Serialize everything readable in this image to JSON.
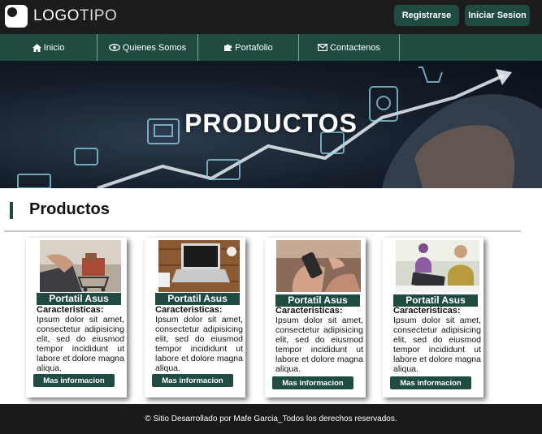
{
  "header": {
    "logo_bold": "LOGO",
    "logo_light": "TIPO",
    "register_label": "Registrarse",
    "login_label": "Iniciar Sesion"
  },
  "nav": {
    "items": [
      {
        "label": "Inicio",
        "icon": "home-icon"
      },
      {
        "label": "Quienes Somos",
        "icon": "eye-icon"
      },
      {
        "label": "Portafolio",
        "icon": "puzzle-icon"
      },
      {
        "label": "Contactenos",
        "icon": "envelope-icon"
      }
    ]
  },
  "hero": {
    "title": "PRODUCTOS"
  },
  "section": {
    "title": "Productos"
  },
  "products": [
    {
      "title": "Portatil Asus",
      "features_label": "Caracteristicas:",
      "description": "Ipsum dolor sit amet, consectetur adipisicing elit, sed do eiusmod tempor incididunt ut labore et dolore magna aliqua.",
      "button": "Mas informacion"
    },
    {
      "title": "Portatil Asus",
      "features_label": "Caracteristicas:",
      "description": "Ipsum dolor sit amet, consectetur adipisicing elit, sed do eiusmod tempor incididunt ut labore et dolore magna aliqua.",
      "button": "Mas informacion"
    },
    {
      "title": "Portatil Asus",
      "features_label": "Caracteristicas:",
      "description": "Ipsum dolor sit amet, consectetur adipisicing elit, sed do eiusmod tempor incididunt ut labore et dolore magna aliqua.",
      "button": "Mas informacion"
    },
    {
      "title": "Portatil Asus",
      "features_label": "Caracteristicas:",
      "description": "Ipsum dolor sit amet, consectetur adipisicing elit, sed do eiusmod tempor incididunt ut labore et dolore magna aliqua.",
      "button": "Mas informacion"
    }
  ],
  "footer": {
    "text": "© Sitio Desarrollado por Mafe Garcia_Todos los derechos reservados."
  },
  "colors": {
    "brand": "#1f4b43",
    "header_bg": "#1c1c1c",
    "footer_bg": "#1a1a1a"
  }
}
